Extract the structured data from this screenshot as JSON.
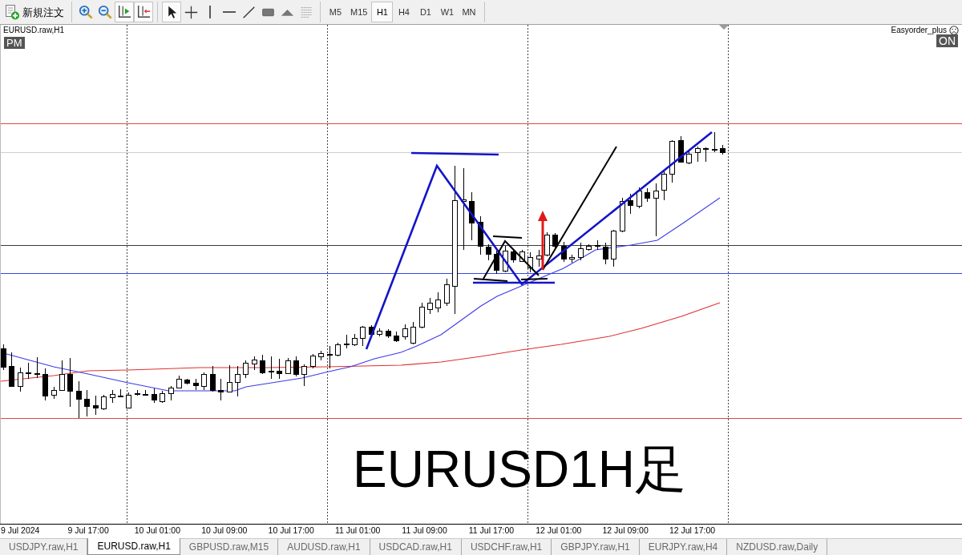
{
  "toolbar": {
    "new_order_label": "新規注文",
    "chart_buttons": [
      {
        "kind": "zoom_in",
        "pressed": false
      },
      {
        "kind": "zoom_out",
        "pressed": false
      },
      {
        "kind": "chart_shift",
        "pressed": true
      },
      {
        "kind": "auto_scroll",
        "pressed": true
      }
    ],
    "drawing_tools": [
      {
        "kind": "cursor",
        "selected": true
      },
      {
        "kind": "crosshair",
        "selected": false
      },
      {
        "kind": "vertical_line",
        "selected": false
      },
      {
        "kind": "horizontal_line",
        "selected": false
      },
      {
        "kind": "trendline",
        "selected": false
      },
      {
        "kind": "rectangle",
        "selected": false
      },
      {
        "kind": "triangle",
        "selected": false
      },
      {
        "kind": "fibonacci",
        "selected": false
      }
    ],
    "timeframes": [
      {
        "label": "M5",
        "selected": false
      },
      {
        "label": "M15",
        "selected": false
      },
      {
        "label": "H1",
        "selected": true
      },
      {
        "label": "H4",
        "selected": false
      },
      {
        "label": "D1",
        "selected": false
      },
      {
        "label": "W1",
        "selected": false
      },
      {
        "label": "MN",
        "selected": false
      }
    ]
  },
  "chart": {
    "title": "EURUSD.raw,H1",
    "session_badge": "PM",
    "expert_name": "Easyorder_plus",
    "expert_status": "ON",
    "caption": "EURUSD1H足",
    "time_axis": [
      "9 Jul 2024",
      "9 Jul 17:00",
      "10 Jul 01:00",
      "10 Jul 09:00",
      "10 Jul 17:00",
      "11 Jul 01:00",
      "11 Jul 09:00",
      "11 Jul 17:00",
      "12 Jul 01:00",
      "12 Jul 09:00",
      "12 Jul 17:00"
    ]
  },
  "tabs": [
    {
      "label": "USDJPY.raw,H1",
      "selected": false
    },
    {
      "label": "EURUSD.raw,H1",
      "selected": true
    },
    {
      "label": "GBPUSD.raw,M15",
      "selected": false
    },
    {
      "label": "AUDUSD.raw,H1",
      "selected": false
    },
    {
      "label": "USDCAD.raw,H1",
      "selected": false
    },
    {
      "label": "USDCHF.raw,H1",
      "selected": false
    },
    {
      "label": "GBPJPY.raw,H1",
      "selected": false
    },
    {
      "label": "EURJPY.raw,H4",
      "selected": false
    },
    {
      "label": "NZDUSD.raw,Daily",
      "selected": false
    }
  ]
}
